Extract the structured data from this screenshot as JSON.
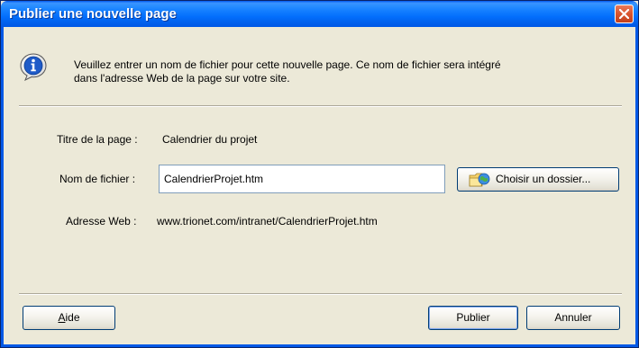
{
  "window": {
    "title": "Publier une nouvelle page",
    "close_icon": "close-icon"
  },
  "info": {
    "icon": "info-icon",
    "message_line1": "Veuillez entrer un nom de fichier pour cette nouvelle page. Ce nom de fichier sera intégré",
    "message_line2": "dans l'adresse Web de la page sur votre site."
  },
  "form": {
    "page_title_label": "Titre de la page :",
    "page_title_value": "Calendrier du projet",
    "filename_label": "Nom de fichier :",
    "filename_value": "CalendrierProjet.htm",
    "choose_folder_label": "Choisir un dossier...",
    "choose_folder_icon": "folder-globe-icon",
    "web_address_label": "Adresse Web :",
    "web_address_value": "www.trionet.com/intranet/CalendrierProjet.htm"
  },
  "buttons": {
    "help_mnemonic": "A",
    "help_rest": "ide",
    "publish": "Publier",
    "cancel": "Annuler"
  }
}
